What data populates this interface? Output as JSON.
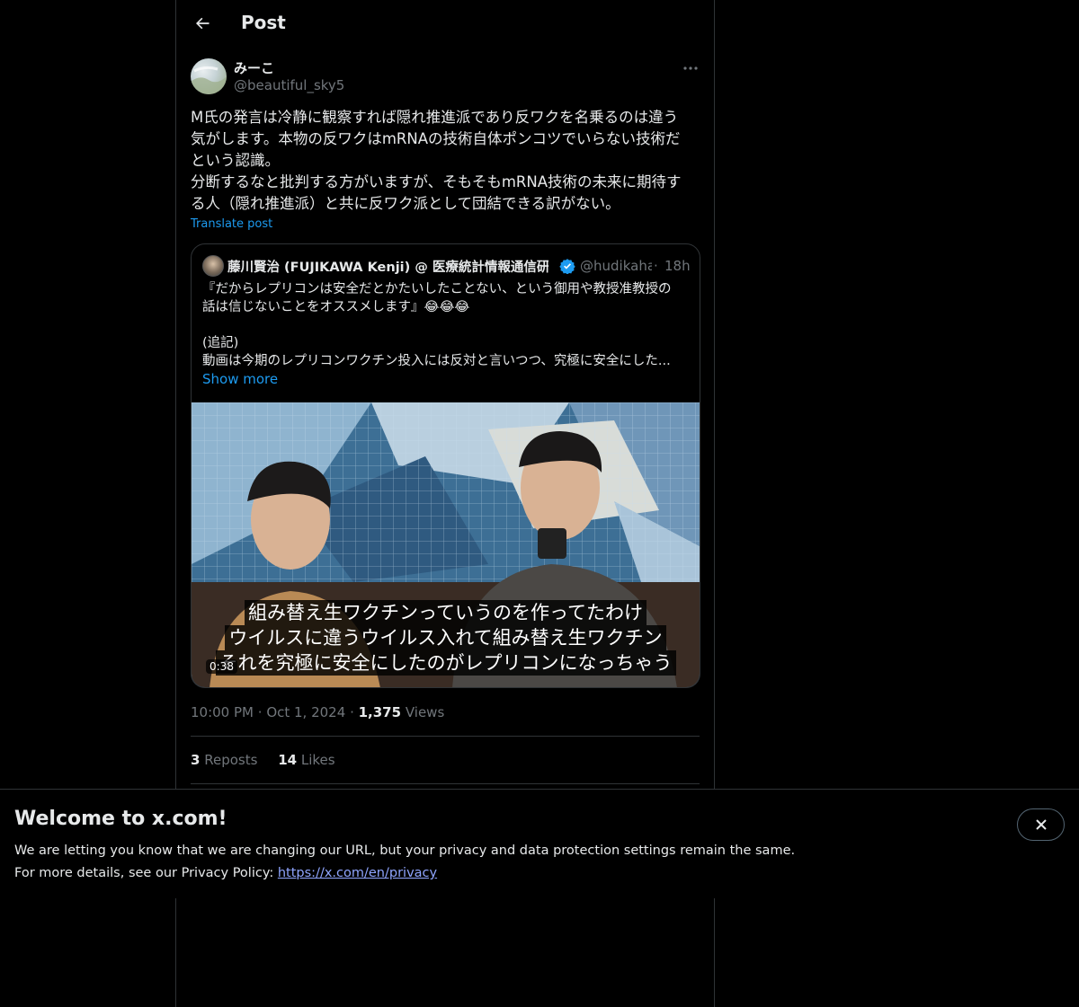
{
  "header": {
    "title": "Post"
  },
  "post": {
    "author_name": "みーこ",
    "author_handle": "@beautiful_sky5",
    "text": "M氏の発言は冷静に観察すれば隠れ推進派であり反ワクを名乗るのは違う\n気がします。本物の反ワクはmRNAの技術自体ポンコツでいらない技術だ\nという認識。\n分断するなと批判する方がいますが、そもそもmRNA技術の未来に期待す\nる人（隠れ推進派）と共に反ワク派として団結できる訳がない。",
    "translate_label": "Translate post",
    "time": "10:00 PM",
    "date": "Oct 1, 2024",
    "views_count": "1,375",
    "views_label": "Views",
    "reposts_count": "3",
    "reposts_label": "Reposts",
    "likes_count": "14",
    "likes_label": "Likes"
  },
  "quote": {
    "author_name": "藤川賢治 (FUJIKAWA Kenji) @ 医療統計情報通信研究所",
    "author_handle": "@hudikaha",
    "time": "18h",
    "text": "『だからレプリコンは安全だとかたいしたことない、という御用や教授准教授の\n話は信じないことをオススメします』😂😂😂\n\n(追記)\n動画は今期のレプリコンワクチン投入には反対と言いつつ、究極に安全にした...",
    "show_more": "Show more",
    "video": {
      "duration": "0:38",
      "subtitles": [
        "組み替え生ワクチンっていうのを作ってたわけ",
        "ウイルスに違うウイルス入れて組み替え生ワクチン",
        "それを究極に安全にしたのがレプリコンになっちゃう"
      ]
    }
  },
  "banner": {
    "title": "Welcome to x.com!",
    "line1": "We are letting you know that we are changing our URL, but your privacy and data protection settings remain the same.",
    "line2_prefix": "For more details, see our Privacy Policy: ",
    "link": "https://x.com/en/privacy"
  },
  "colors": {
    "accent": "#1d9bf0",
    "background": "#000000",
    "border": "#2f3336",
    "muted": "#71767b"
  },
  "icons": [
    "back-arrow-icon",
    "more-icon",
    "verified-badge-icon",
    "close-icon"
  ]
}
